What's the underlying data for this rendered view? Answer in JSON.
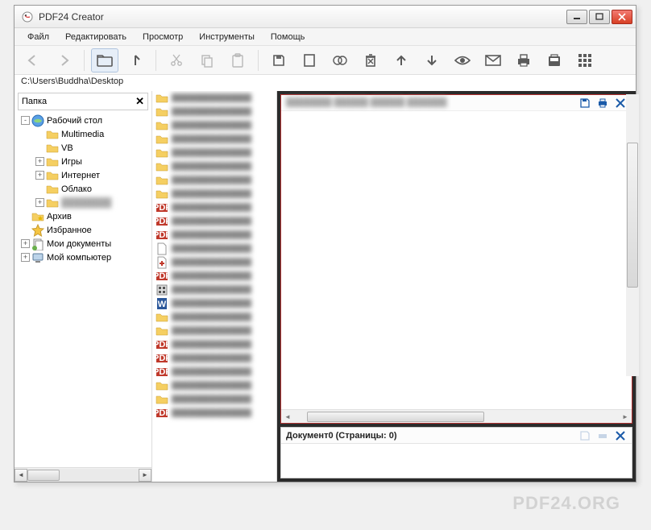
{
  "window": {
    "title": "PDF24 Creator"
  },
  "menu": {
    "items": [
      "Файл",
      "Редактировать",
      "Просмотр",
      "Инструменты",
      "Помощь"
    ]
  },
  "path": "C:\\Users\\Buddha\\Desktop",
  "tree": {
    "header": "Папка",
    "nodes": [
      {
        "label": "Рабочий стол",
        "icon": "desktop",
        "indent": 0,
        "exp": "-"
      },
      {
        "label": "Multimedia",
        "icon": "folder",
        "indent": 1,
        "exp": ""
      },
      {
        "label": "VB",
        "icon": "folder",
        "indent": 1,
        "exp": ""
      },
      {
        "label": "Игры",
        "icon": "folder",
        "indent": 1,
        "exp": "+"
      },
      {
        "label": "Интернет",
        "icon": "folder",
        "indent": 1,
        "exp": "+"
      },
      {
        "label": "Облако",
        "icon": "folder",
        "indent": 1,
        "exp": ""
      },
      {
        "label": "",
        "icon": "folder",
        "indent": 1,
        "exp": "+",
        "blur": true
      },
      {
        "label": "Архив",
        "icon": "folder-star",
        "indent": 0,
        "exp": ""
      },
      {
        "label": "Избранное",
        "icon": "star",
        "indent": 0,
        "exp": ""
      },
      {
        "label": "Мои документы",
        "icon": "documents",
        "indent": 0,
        "exp": "+"
      },
      {
        "label": "Мой компьютер",
        "icon": "computer",
        "indent": 0,
        "exp": "+"
      }
    ]
  },
  "files": [
    {
      "icon": "folder"
    },
    {
      "icon": "folder"
    },
    {
      "icon": "folder"
    },
    {
      "icon": "folder"
    },
    {
      "icon": "folder"
    },
    {
      "icon": "folder"
    },
    {
      "icon": "folder"
    },
    {
      "icon": "folder"
    },
    {
      "icon": "pdf"
    },
    {
      "icon": "pdf"
    },
    {
      "icon": "pdf"
    },
    {
      "icon": "file"
    },
    {
      "icon": "file-plus"
    },
    {
      "icon": "pdf"
    },
    {
      "icon": "app"
    },
    {
      "icon": "word"
    },
    {
      "icon": "folder"
    },
    {
      "icon": "folder"
    },
    {
      "icon": "pdf"
    },
    {
      "icon": "pdf"
    },
    {
      "icon": "pdf"
    },
    {
      "icon": "folder"
    },
    {
      "icon": "folder"
    },
    {
      "icon": "pdf"
    }
  ],
  "preview_top": {
    "actions": [
      "save",
      "print",
      "close"
    ]
  },
  "preview_bottom": {
    "title": "Документ0 (Страницы: 0)"
  },
  "watermark": "PDF24.ORG"
}
